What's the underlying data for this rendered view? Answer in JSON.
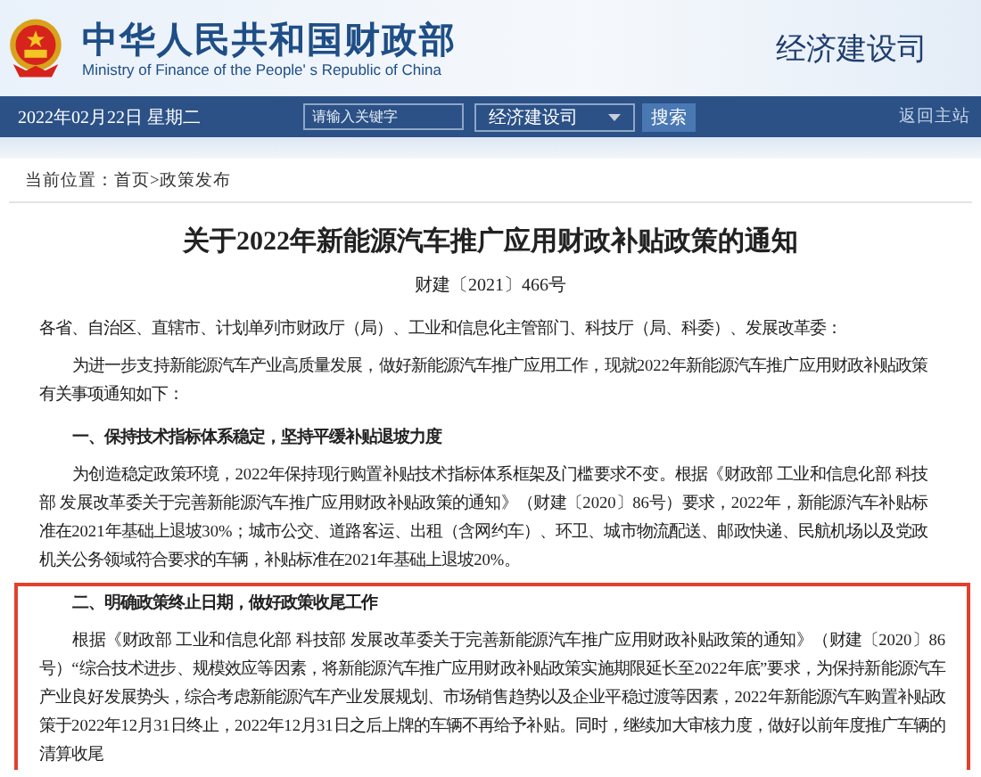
{
  "header": {
    "name_cn": "中华人民共和国财政部",
    "name_en": "Ministry of Finance of the People' s Republic of China",
    "department": "经济建设司"
  },
  "nav": {
    "date": "2022年02月22日  星期二",
    "search": {
      "placeholder": "请输入关键字"
    },
    "scope": "经济建设司",
    "search_button": "搜索",
    "home_link": "返回主站"
  },
  "breadcrumb": "当前位置：首页>政策发布",
  "article": {
    "title": "关于2022年新能源汽车推广应用财政补贴政策的通知",
    "doc_number": "财建〔2021〕466号",
    "blocks": [
      {
        "kind": "salutation",
        "text": "各省、自治区、直辖市、计划单列市财政厅（局）、工业和信息化主管部门、科技厅（局、科委）、发展改革委：",
        "highlighted": false
      },
      {
        "kind": "paragraph",
        "text": "为进一步支持新能源汽车产业高质量发展，做好新能源汽车推广应用工作，现就2022年新能源汽车推广应用财政补贴政策有关事项通知如下：",
        "highlighted": false
      },
      {
        "kind": "heading",
        "text": "一、保持技术指标体系稳定，坚持平缓补贴退坡力度",
        "highlighted": false
      },
      {
        "kind": "paragraph",
        "text": "为创造稳定政策环境，2022年保持现行购置补贴技术指标体系框架及门槛要求不变。根据《财政部 工业和信息化部 科技部 发展改革委关于完善新能源汽车推广应用财政补贴政策的通知》（财建〔2020〕86号）要求，2022年，新能源汽车补贴标准在2021年基础上退坡30%；城市公交、道路客运、出租（含网约车）、环卫、城市物流配送、邮政快递、民航机场以及党政机关公务领域符合要求的车辆，补贴标准在2021年基础上退坡20%。",
        "highlighted": false
      },
      {
        "kind": "heading",
        "text": "二、明确政策终止日期，做好政策收尾工作",
        "highlighted": true
      },
      {
        "kind": "paragraph",
        "text": "根据《财政部 工业和信息化部 科技部 发展改革委关于完善新能源汽车推广应用财政补贴政策的通知》（财建〔2020〕86号）“综合技术进步、规模效应等因素，将新能源汽车推广应用财政补贴政策实施期限延长至2022年底”要求，为保持新能源汽车产业良好发展势头，综合考虑新能源汽车产业发展规划、市场销售趋势以及企业平稳过渡等因素，2022年新能源汽车购置补贴政策于2022年12月31日终止，2022年12月31日之后上牌的车辆不再给予补贴。同时，继续加大审核力度，做好以前年度推广车辆的清算收尾",
        "highlighted": true
      }
    ]
  }
}
